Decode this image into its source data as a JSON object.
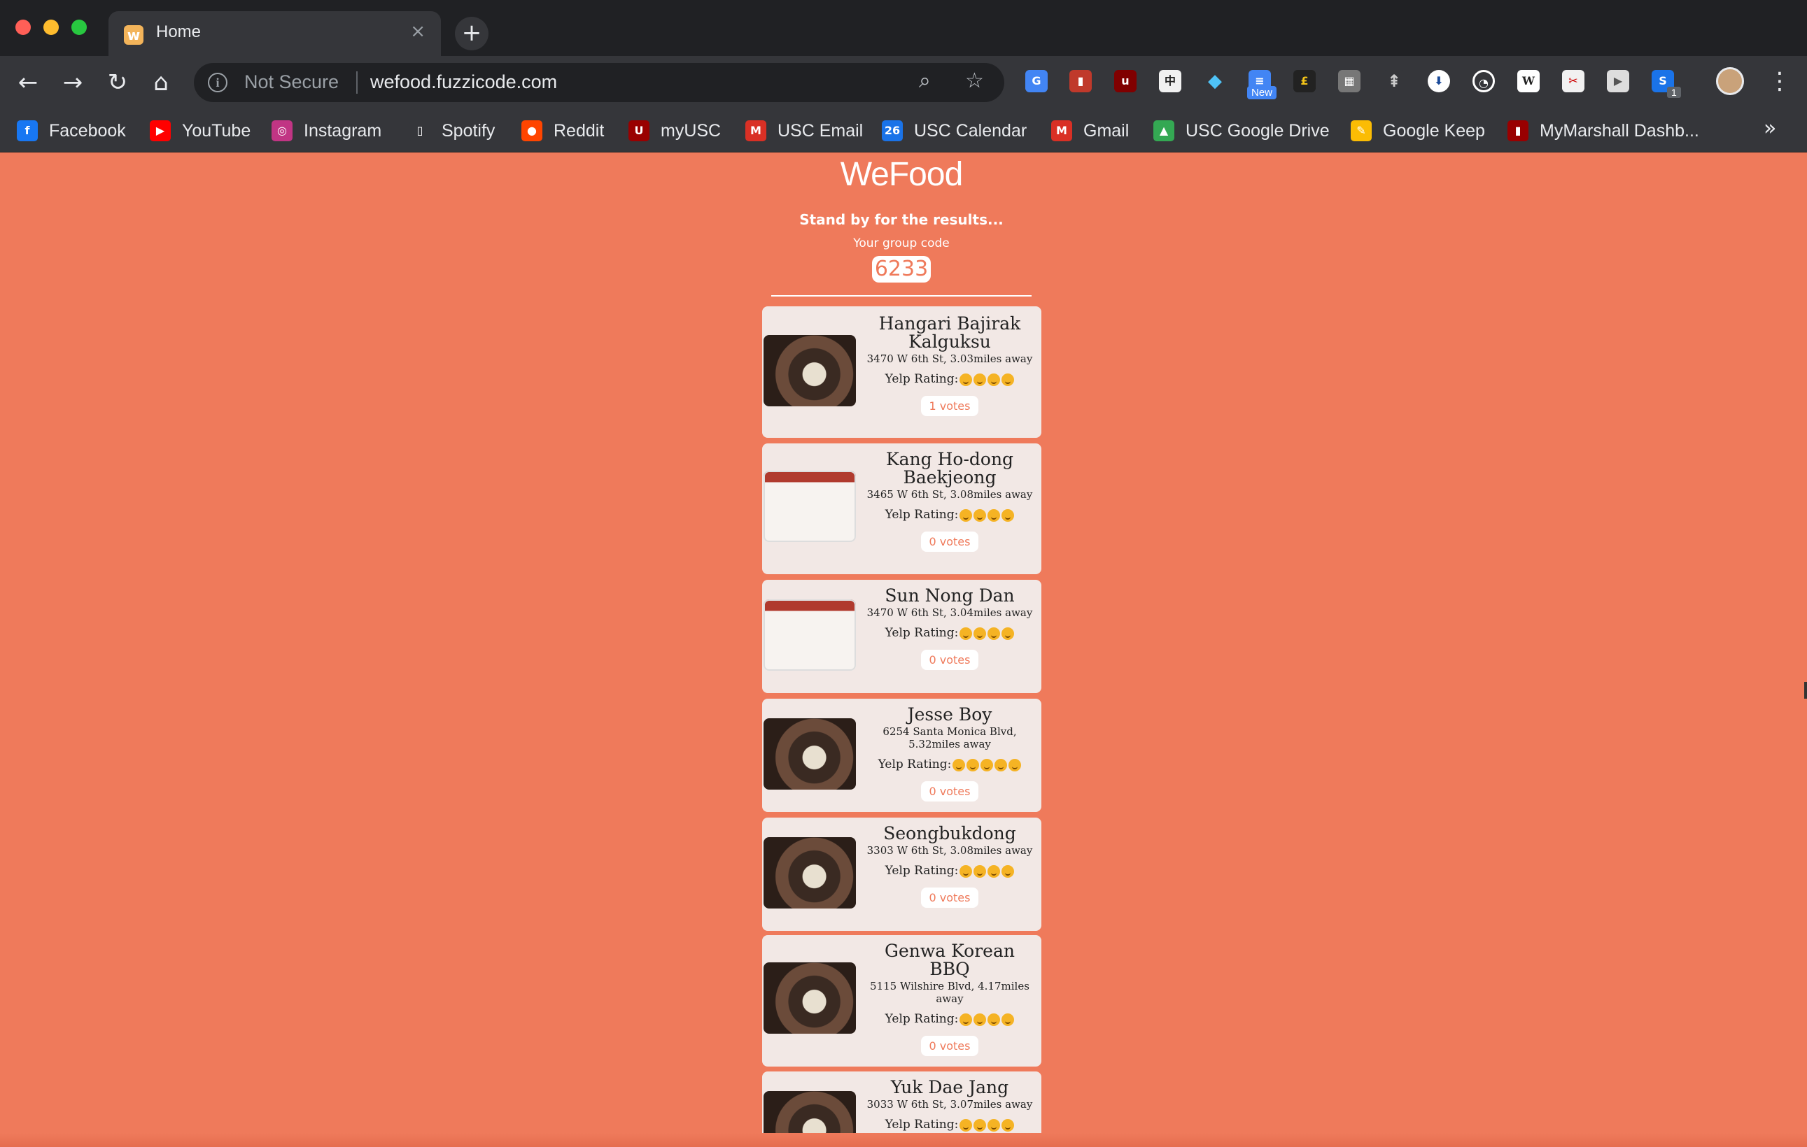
{
  "browser": {
    "tab_title": "Home",
    "tab_close": "×",
    "new_tab": "+",
    "not_secure": "Not Secure",
    "url": "wefood.fuzzicode.com",
    "zoom_icon": "magnifier-icon",
    "star_icon": "bookmark-star-icon",
    "ext_new_badge": "New",
    "ext_count_badge": "1",
    "more_bookmarks": "»"
  },
  "bookmarks": [
    {
      "label": "Facebook",
      "icon": "facebook-icon",
      "color": "#1877f2",
      "glyph": "f"
    },
    {
      "label": "YouTube",
      "icon": "youtube-icon",
      "color": "#ff0000",
      "glyph": "▶"
    },
    {
      "label": "Instagram",
      "icon": "instagram-icon",
      "color": "#c13584",
      "glyph": "◎"
    },
    {
      "label": "Spotify",
      "icon": "document-icon",
      "color": "#35363a",
      "glyph": "▯"
    },
    {
      "label": "Reddit",
      "icon": "reddit-icon",
      "color": "#ff4500",
      "glyph": "●"
    },
    {
      "label": "myUSC",
      "icon": "usc-icon",
      "color": "#990000",
      "glyph": "U"
    },
    {
      "label": "USC Email",
      "icon": "gmail-icon",
      "color": "#d93025",
      "glyph": "M"
    },
    {
      "label": "USC Calendar",
      "icon": "calendar-icon",
      "color": "#1a73e8",
      "glyph": "26"
    },
    {
      "label": "Gmail",
      "icon": "gmail-icon",
      "color": "#d93025",
      "glyph": "M"
    },
    {
      "label": "USC Google Drive",
      "icon": "drive-icon",
      "color": "#34a853",
      "glyph": "▲"
    },
    {
      "label": "Google Keep",
      "icon": "keep-icon",
      "color": "#fbbc04",
      "glyph": "✎"
    },
    {
      "label": "MyMarshall Dashb...",
      "icon": "marshall-icon",
      "color": "#990000",
      "glyph": "▮"
    }
  ],
  "page": {
    "title": "WeFood",
    "standby": "Stand by for the results...",
    "code_label": "Your group code",
    "group_code": "6233"
  },
  "restaurants": [
    {
      "name": "Hangari Bajirak Kalguksu",
      "address": "3470 W 6th St, 3.03miles away",
      "rating_label": "Yelp Rating:",
      "rating": 4,
      "votes": "1 votes",
      "image": "food-photo"
    },
    {
      "name": "Kang Ho-dong Baekjeong",
      "address": "3465 W 6th St, 3.08miles away",
      "rating_label": "Yelp Rating:",
      "rating": 4,
      "votes": "0 votes",
      "image": "article-screenshot"
    },
    {
      "name": "Sun Nong Dan",
      "address": "3470 W 6th St, 3.04miles away",
      "rating_label": "Yelp Rating:",
      "rating": 4,
      "votes": "0 votes",
      "image": "article-screenshot"
    },
    {
      "name": "Jesse Boy",
      "address": "6254 Santa Monica Blvd, 5.32miles away",
      "rating_label": "Yelp Rating:",
      "rating": 5,
      "votes": "0 votes",
      "image": "food-photo"
    },
    {
      "name": "Seongbukdong",
      "address": "3303 W 6th St, 3.08miles away",
      "rating_label": "Yelp Rating:",
      "rating": 4,
      "votes": "0 votes",
      "image": "food-photo"
    },
    {
      "name": "Genwa Korean BBQ",
      "address": "5115 Wilshire Blvd, 4.17miles away",
      "rating_label": "Yelp Rating:",
      "rating": 4,
      "votes": "0 votes",
      "image": "food-photo"
    },
    {
      "name": "Yuk Dae Jang",
      "address": "3033 W 6th St, 3.07miles away",
      "rating_label": "Yelp Rating:",
      "rating": 4,
      "votes": "",
      "image": "food-photo"
    }
  ],
  "colors": {
    "page_bg": "#ef7a5b",
    "card_bg": "#f2e8e5",
    "accent": "#ef7a5b"
  }
}
